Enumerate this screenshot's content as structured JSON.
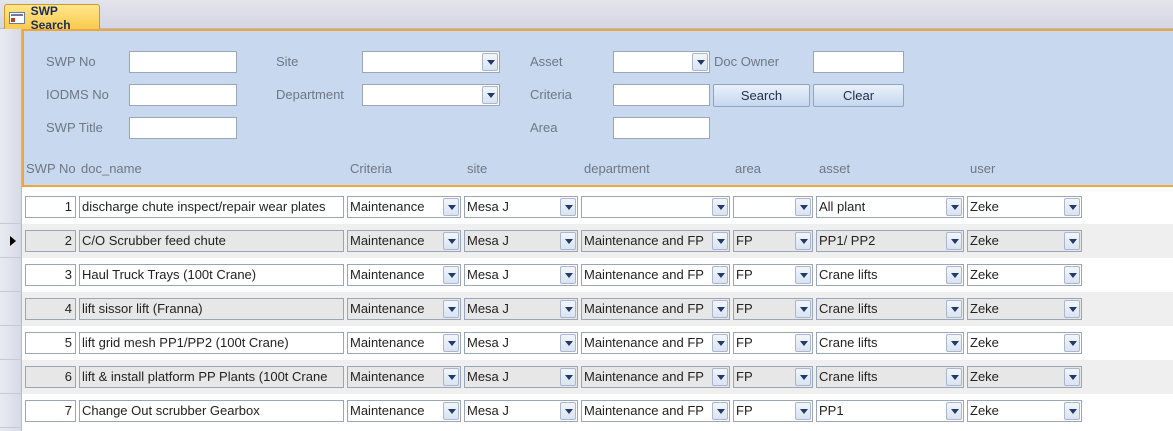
{
  "tab": {
    "title": "SWP Search",
    "icon": "form-icon"
  },
  "search": {
    "swp_no_label": "SWP No",
    "iodms_no_label": "IODMS No",
    "swp_title_label": "SWP Title",
    "site_label": "Site",
    "department_label": "Department",
    "asset_label": "Asset",
    "criteria_label": "Criteria",
    "area_label": "Area",
    "doc_owner_label": "Doc Owner",
    "swp_no_value": "",
    "iodms_no_value": "",
    "swp_title_value": "",
    "site_value": "",
    "department_value": "",
    "asset_value": "",
    "criteria_value": "",
    "area_value": "",
    "doc_owner_value": "",
    "search_button": "Search",
    "clear_button": "Clear"
  },
  "columns": {
    "swp_no": "SWP No",
    "doc_name": "doc_name",
    "criteria": "Criteria",
    "site": "site",
    "department": "department",
    "area": "area",
    "asset": "asset",
    "user": "user"
  },
  "rows": [
    {
      "swp_no": "1",
      "doc_name": "discharge chute inspect/repair wear plates",
      "criteria": "Maintenance",
      "site": "Mesa J",
      "department": "",
      "area": "",
      "asset": "All plant",
      "user": "Zeke"
    },
    {
      "swp_no": "2",
      "doc_name": "C/O Scrubber feed chute",
      "criteria": "Maintenance",
      "site": "Mesa J",
      "department": "Maintenance and FP",
      "area": "FP",
      "asset": "PP1/ PP2",
      "user": "Zeke"
    },
    {
      "swp_no": "3",
      "doc_name": "Haul Truck Trays (100t Crane)",
      "criteria": "Maintenance",
      "site": "Mesa J",
      "department": "Maintenance and FP",
      "area": "FP",
      "asset": "Crane lifts",
      "user": "Zeke"
    },
    {
      "swp_no": "4",
      "doc_name": "lift sissor lift (Franna)",
      "criteria": "Maintenance",
      "site": "Mesa J",
      "department": "Maintenance and FP",
      "area": "FP",
      "asset": "Crane lifts",
      "user": "Zeke"
    },
    {
      "swp_no": "5",
      "doc_name": "lift grid mesh PP1/PP2 (100t Crane)",
      "criteria": "Maintenance",
      "site": "Mesa J",
      "department": "Maintenance and FP",
      "area": "FP",
      "asset": "Crane lifts",
      "user": "Zeke"
    },
    {
      "swp_no": "6",
      "doc_name": "lift & install platform PP Plants (100t Crane",
      "criteria": "Maintenance",
      "site": "Mesa J",
      "department": "Maintenance and FP",
      "area": "FP",
      "asset": "Crane lifts",
      "user": "Zeke"
    },
    {
      "swp_no": "7",
      "doc_name": "Change Out scrubber Gearbox",
      "criteria": "Maintenance",
      "site": "Mesa J",
      "department": "Maintenance and FP",
      "area": "FP",
      "asset": "PP1",
      "user": "Zeke"
    }
  ],
  "current_record_index": 1
}
